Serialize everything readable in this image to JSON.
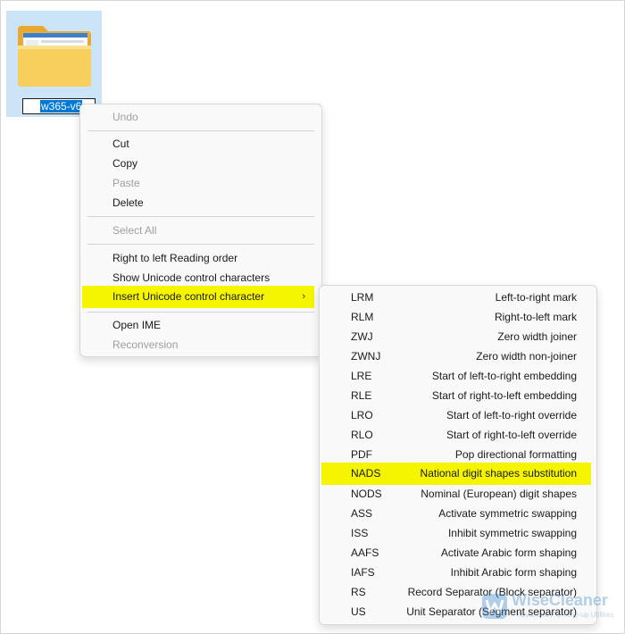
{
  "folder": {
    "name_selected": "w365-v6",
    "icon": "folder-icon"
  },
  "context_menu": {
    "items": [
      {
        "label": "Undo",
        "enabled": false
      },
      {
        "label": "Cut",
        "enabled": true
      },
      {
        "label": "Copy",
        "enabled": true
      },
      {
        "label": "Paste",
        "enabled": false
      },
      {
        "label": "Delete",
        "enabled": true
      },
      {
        "label": "Select All",
        "enabled": false
      },
      {
        "label": "Right to left Reading order",
        "enabled": true
      },
      {
        "label": "Show Unicode control characters",
        "enabled": true
      },
      {
        "label": "Insert Unicode control character",
        "enabled": true,
        "highlighted": true,
        "submenu_icon": "chevron-right-icon"
      },
      {
        "label": "Open IME",
        "enabled": true
      },
      {
        "label": "Reconversion",
        "enabled": false
      }
    ]
  },
  "submenu": {
    "items": [
      {
        "code": "LRM",
        "desc": "Left-to-right mark"
      },
      {
        "code": "RLM",
        "desc": "Right-to-left mark"
      },
      {
        "code": "ZWJ",
        "desc": "Zero width joiner"
      },
      {
        "code": "ZWNJ",
        "desc": "Zero width non-joiner"
      },
      {
        "code": "LRE",
        "desc": "Start of left-to-right embedding"
      },
      {
        "code": "RLE",
        "desc": "Start of right-to-left embedding"
      },
      {
        "code": "LRO",
        "desc": "Start of left-to-right override"
      },
      {
        "code": "RLO",
        "desc": "Start of right-to-left override"
      },
      {
        "code": "PDF",
        "desc": "Pop directional formatting"
      },
      {
        "code": "NADS",
        "desc": "National digit shapes substitution",
        "highlighted": true
      },
      {
        "code": "NODS",
        "desc": "Nominal (European) digit shapes"
      },
      {
        "code": "ASS",
        "desc": "Activate symmetric swapping"
      },
      {
        "code": "ISS",
        "desc": "Inhibit symmetric swapping"
      },
      {
        "code": "AAFS",
        "desc": "Activate Arabic form shaping"
      },
      {
        "code": "IAFS",
        "desc": "Inhibit Arabic form shaping"
      },
      {
        "code": "RS",
        "desc": "Record Separator (Block separator)"
      },
      {
        "code": "US",
        "desc": "Unit Separator (Segment separator)"
      }
    ]
  },
  "watermark": {
    "name": "WiseCleaner",
    "tagline": "Advanced PC Tune-up Utilities",
    "icon": "wisecleaner-logo-icon"
  },
  "colors": {
    "highlight": "#f5f500",
    "selection": "#0078d7",
    "tile": "#cce4f7",
    "disabled_text": "#9e9e9e"
  }
}
